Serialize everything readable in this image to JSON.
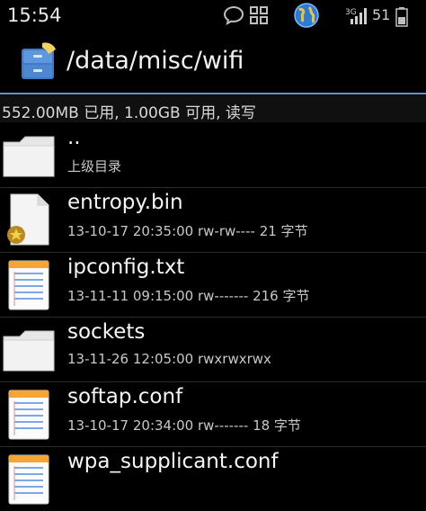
{
  "status_bar": {
    "time": "15:54",
    "signal_label": "3G",
    "battery_level": "51",
    "icons": [
      "chat-bubble-icon",
      "grid-icon",
      "globe-icon",
      "signal-icon",
      "battery-icon"
    ]
  },
  "header": {
    "path": "/data/misc/wifi",
    "app_icon": "file-cabinet-icon"
  },
  "storage": {
    "summary": "552.00MB 已用, 1.00GB 可用, 读写"
  },
  "files": [
    {
      "name": "..",
      "meta": "上级目录",
      "icon": "folder-icon"
    },
    {
      "name": "entropy.bin",
      "meta": "13-10-17 20:35:00  rw-rw----  21 字节",
      "icon": "locked-file-icon"
    },
    {
      "name": "ipconfig.txt",
      "meta": "13-11-11 09:15:00  rw-------  216 字节",
      "icon": "text-file-icon"
    },
    {
      "name": "sockets",
      "meta": "13-11-26 12:05:00  rwxrwxrwx",
      "icon": "folder-icon"
    },
    {
      "name": "softap.conf",
      "meta": "13-10-17 20:34:00  rw-------  18 字节",
      "icon": "text-file-icon"
    },
    {
      "name": "wpa_supplicant.conf",
      "meta": "",
      "icon": "text-file-icon"
    }
  ],
  "colors": {
    "background": "#000000",
    "divider": "#6f8fc7",
    "text_primary": "#f5f5f5",
    "text_secondary": "#c8c8c8"
  }
}
